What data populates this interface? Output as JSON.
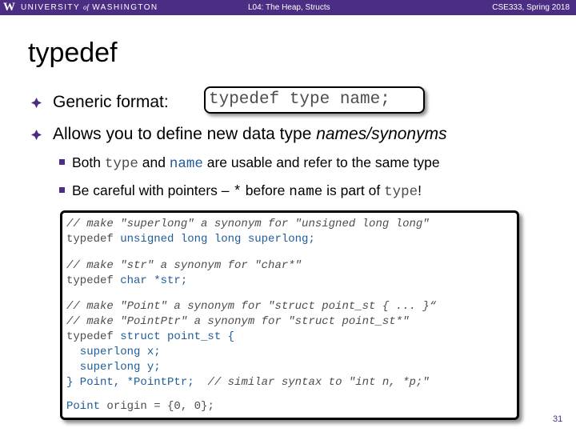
{
  "header": {
    "logo": "W",
    "university_pre": "UNIVERSITY ",
    "university_of": "of",
    "university_post": " WASHINGTON",
    "lecture": "L04: The Heap, Structs",
    "course": "CSE333, Spring 2018",
    "bar_color": "#4b2e83"
  },
  "slide": {
    "title": "typedef",
    "bullet1": {
      "label": "Generic format:",
      "code": "typedef type name;"
    },
    "bullet2": {
      "text": "Allows you to define new data type ",
      "italic": "names/synonyms"
    },
    "sub1": {
      "t1": "Both ",
      "c1": "type",
      "t2": " and ",
      "c2": "name",
      "t3": " are usable and refer to the same type"
    },
    "sub2": {
      "t1": "Be careful with pointers – ",
      "c1": "*",
      "t2": " before ",
      "c2": "name",
      "t3": " is part of ",
      "c3": "type",
      "t4": "!"
    },
    "code": {
      "l1": "// make \"superlong\" a synonym for \"unsigned long long\"",
      "l2a": "typedef",
      "l2b": " unsigned long long superlong;",
      "l3": "// make \"str\" a synonym for \"char*\"",
      "l4a": "typedef",
      "l4b": " char *str;",
      "l5": "// make \"Point\" a synonym for \"struct point_st { ... }“",
      "l6": "// make \"PointPtr\" a synonym for \"struct point_st*\"",
      "l7a": "typedef",
      "l7b": " struct point_st {",
      "l8": "  superlong x;",
      "l9": "  superlong y;",
      "l10a": "} Point, *PointPtr;  ",
      "l10b": "// similar syntax to \"int n, *p;\"",
      "l11a": "Point",
      "l11b": " origin = {0, 0};"
    },
    "page_number": "31"
  }
}
